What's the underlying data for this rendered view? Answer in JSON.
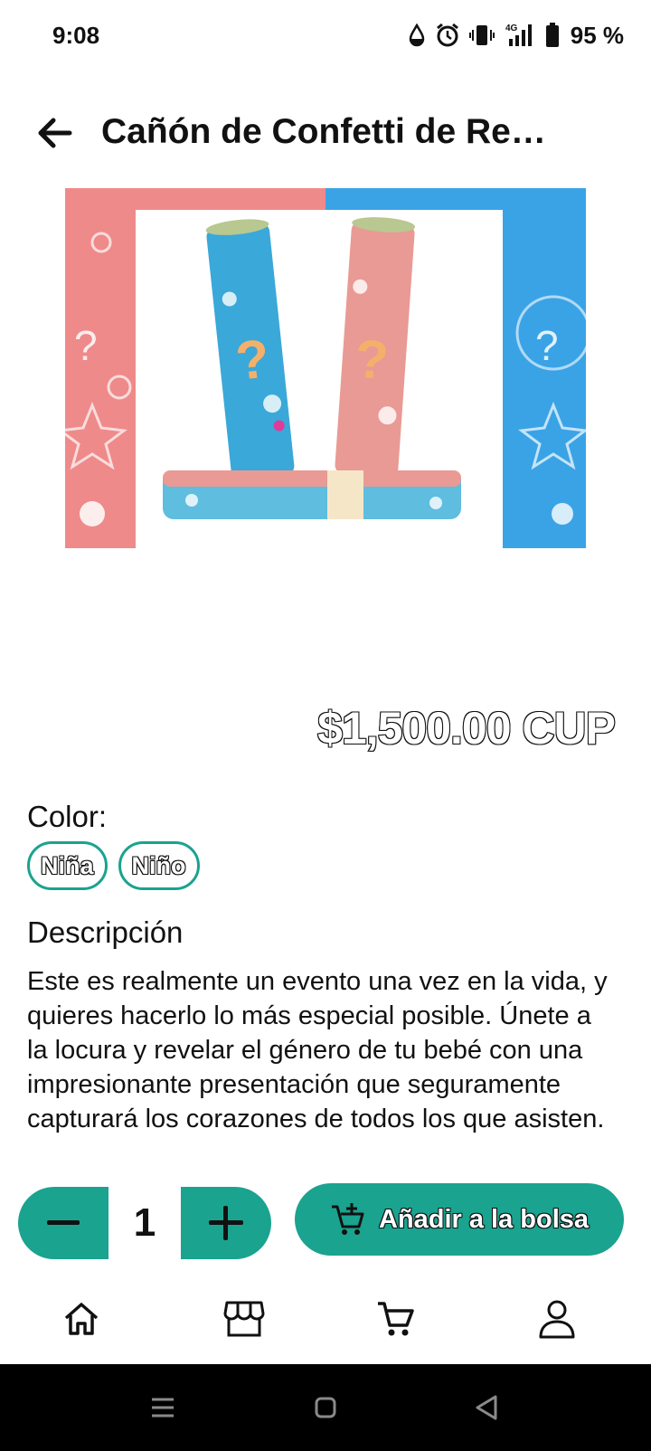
{
  "status_bar": {
    "time": "9:08",
    "network": "4G",
    "battery": "95 %",
    "icons": [
      "water-drop-icon",
      "alarm-icon",
      "vibrate-icon",
      "signal-icon",
      "battery-icon"
    ]
  },
  "header": {
    "title": "Cañón de Confetti de Re…",
    "back_icon": "arrow-left-icon"
  },
  "product": {
    "image_alt": "confetti cannons",
    "price": "$1,500.00 CUP"
  },
  "options": {
    "color_label": "Color:",
    "colors": [
      "Niña",
      "Niño"
    ]
  },
  "description": {
    "title": "Descripción",
    "text": "Este es realmente un evento una vez en la vida, y quieres hacerlo lo más especial posible. Únete a la locura y revelar el género de tu bebé con una impresionante presentación que seguramente capturará los corazones de todos los que asisten."
  },
  "cart": {
    "quantity": "1",
    "add_label": "Añadir a la bolsa"
  },
  "colors": {
    "accent": "#1aa38f",
    "pink": "#ef8a8a",
    "blue": "#3aa3e6"
  },
  "bottom_nav": [
    "home-icon",
    "store-icon",
    "cart-icon",
    "user-icon"
  ],
  "system_nav": [
    "recents-icon",
    "home-circle-icon",
    "back-triangle-icon"
  ]
}
